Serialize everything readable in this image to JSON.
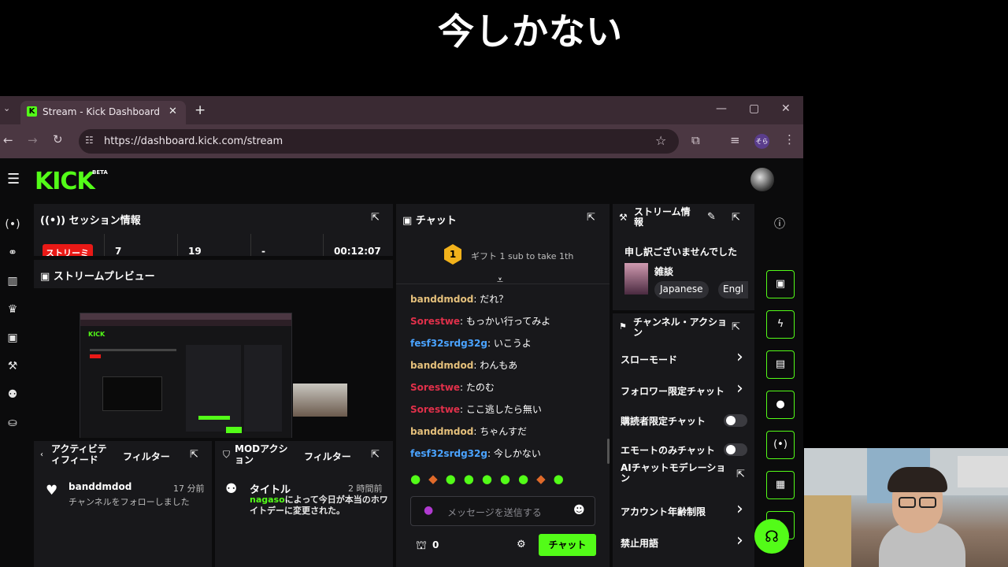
{
  "caption": "今しかない",
  "browser": {
    "tab_title": "Stream - Kick Dashboard",
    "url": "https://dashboard.kick.com/stream",
    "profile_badge": "そら"
  },
  "app": {
    "logo": "KICK",
    "beta": "BETA"
  },
  "session": {
    "title": "セッション情報",
    "status_badge": "ストリーミ",
    "stat1": "7",
    "stat2": "19",
    "stat3": "-",
    "time": "00:12:07"
  },
  "preview": {
    "title": "ストリームプレビュー"
  },
  "activity": {
    "title": "アクティビティフィード",
    "filter": "フィルター",
    "user": "banddmdod",
    "time": "17 分前",
    "text": "チャンネルをフォローしました"
  },
  "mod": {
    "title": "MODアクション",
    "filter": "フィルター",
    "heading": "タイトル",
    "time": "2 時間前",
    "actor": "nagaso",
    "text": "によって今日が本当のホワイトデーに変更された。"
  },
  "chat": {
    "title": "チャット",
    "gift_count": "1",
    "gift_text": "ギフト 1 sub to take 1th",
    "messages": [
      {
        "user": "banddmdod",
        "text": "だれ？",
        "color": "u1"
      },
      {
        "user": "Sorestwe",
        "text": "もっかい行ってみよ",
        "color": "u2"
      },
      {
        "user": "fesf32srdg32g",
        "text": "いこうよ",
        "color": "u3"
      },
      {
        "user": "banddmdod",
        "text": "わんもあ",
        "color": "u1"
      },
      {
        "user": "Sorestwe",
        "text": "たのむ",
        "color": "u2"
      },
      {
        "user": "Sorestwe",
        "text": "ここ逃したら無い",
        "color": "u2"
      },
      {
        "user": "banddmdod",
        "text": "ちゃんすだ",
        "color": "u1"
      },
      {
        "user": "fesf32srdg32g",
        "text": "今しかない",
        "color": "u3"
      }
    ],
    "input_placeholder": "メッセージを送信する",
    "points": "0",
    "send": "チャット"
  },
  "stream_info": {
    "title": "ストリーム情報",
    "stream_title": "申し訳ございませんでした",
    "category": "雑談",
    "tags": [
      "Japanese",
      "Engl"
    ]
  },
  "channel_actions": {
    "title": "チャンネル・アクション",
    "items": [
      {
        "label": "スローモード",
        "kind": "chevron"
      },
      {
        "label": "フォロワー限定チャット",
        "kind": "chevron"
      },
      {
        "label": "購読者限定チャット",
        "kind": "toggle"
      },
      {
        "label": "エモートのみチャット",
        "kind": "toggle"
      },
      {
        "label": "AIチャットモデレーション",
        "kind": "external"
      },
      {
        "label": "アカウント年齢制限",
        "kind": "chevron"
      },
      {
        "label": "禁止用語",
        "kind": "chevron"
      }
    ]
  },
  "colors": {
    "accent": "#53fc18",
    "badge": "#e91916"
  }
}
